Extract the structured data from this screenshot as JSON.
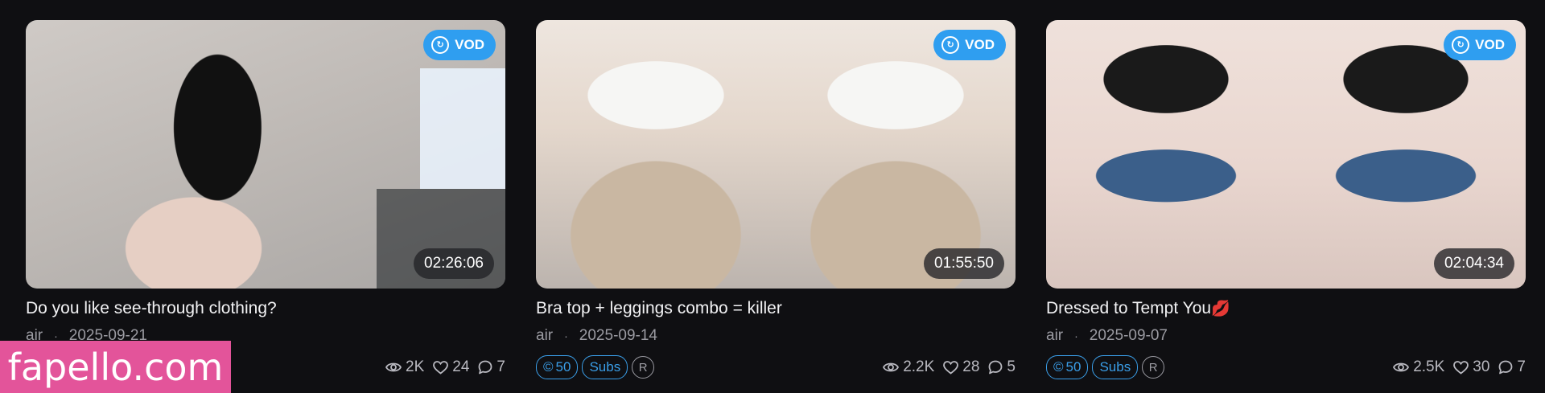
{
  "cards": [
    {
      "title": "Do you like see-through clothing?",
      "title_emoji": "",
      "author": "air",
      "date": "2025-09-21",
      "badge": "VOD",
      "duration": "02:26:06",
      "price": "",
      "subs_label": "",
      "r_label": "",
      "views": "2K",
      "likes": "24",
      "comments": "7"
    },
    {
      "title": "Bra top + leggings combo = killer",
      "title_emoji": "",
      "author": "air",
      "date": "2025-09-14",
      "badge": "VOD",
      "duration": "01:55:50",
      "price": "50",
      "subs_label": "Subs",
      "r_label": "R",
      "views": "2.2K",
      "likes": "28",
      "comments": "5"
    },
    {
      "title": "Dressed to Tempt You",
      "title_emoji": "💋",
      "author": "air",
      "date": "2025-09-07",
      "badge": "VOD",
      "duration": "02:04:34",
      "price": "50",
      "subs_label": "Subs",
      "r_label": "R",
      "views": "2.5K",
      "likes": "30",
      "comments": "7"
    }
  ],
  "meta_separator": "·",
  "currency_symbol": "©",
  "watermark": "fapello.com",
  "colors": {
    "accent": "#2f9ef0",
    "watermark_bg": "#e3549a",
    "background": "#0f0f12"
  },
  "icons": {
    "badge": "replay-icon",
    "views": "eye-icon",
    "likes": "heart-icon",
    "comments": "chat-bubble-icon"
  }
}
